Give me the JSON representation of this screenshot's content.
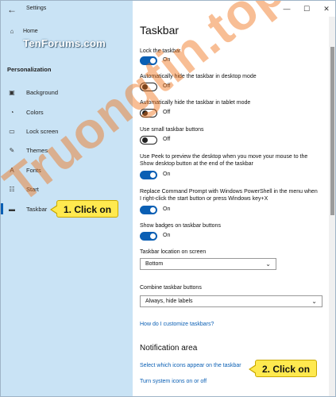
{
  "window": {
    "title": "Settings",
    "controls": {
      "minimize": "—",
      "maximize": "☐",
      "close": "✕"
    }
  },
  "sidebar": {
    "home_label": "Home",
    "watermark": "TenForums.com",
    "section": "Personalization",
    "items": [
      {
        "label": "Background",
        "icon": "background-icon",
        "glyph": "▣"
      },
      {
        "label": "Colors",
        "icon": "palette-icon",
        "glyph": "◔"
      },
      {
        "label": "Lock screen",
        "icon": "lock-screen-icon",
        "glyph": "▭"
      },
      {
        "label": "Themes",
        "icon": "brush-icon",
        "glyph": "✎"
      },
      {
        "label": "Fonts",
        "icon": "font-icon",
        "glyph": "A"
      },
      {
        "label": "Start",
        "icon": "start-icon",
        "glyph": "☷"
      },
      {
        "label": "Taskbar",
        "icon": "taskbar-icon",
        "glyph": "▬",
        "active": true
      }
    ]
  },
  "callouts": {
    "first": "1. Click on",
    "second": "2. Click on"
  },
  "main": {
    "title": "Taskbar",
    "settings": [
      {
        "label": "Lock the taskbar",
        "state": "On"
      },
      {
        "label": "Automatically hide the taskbar in desktop mode",
        "state": "Off"
      },
      {
        "label": "Automatically hide the taskbar in tablet mode",
        "state": "Off"
      },
      {
        "label": "Use small taskbar buttons",
        "state": "Off"
      },
      {
        "label": "Use Peek to preview the desktop when you move your mouse to the Show desktop button at the end of the taskbar",
        "state": "On"
      },
      {
        "label": "Replace Command Prompt with Windows PowerShell in the menu when I right-click the start button or press Windows key+X",
        "state": "On"
      },
      {
        "label": "Show badges on taskbar buttons",
        "state": "On"
      }
    ],
    "location_label": "Taskbar location on screen",
    "location_value": "Bottom",
    "combine_label": "Combine taskbar buttons",
    "combine_value": "Always, hide labels",
    "customize_link": "How do I customize taskbars?",
    "notification_heading": "Notification area",
    "select_icons_link": "Select which icons appear on the taskbar",
    "system_icons_link": "Turn system icons on or off"
  },
  "watermark_big": "Truongtin.top",
  "colors": {
    "accent": "#0a5fb4",
    "sidebar_bg": "#c9e3f5",
    "callout_bg": "#ffe94f"
  }
}
